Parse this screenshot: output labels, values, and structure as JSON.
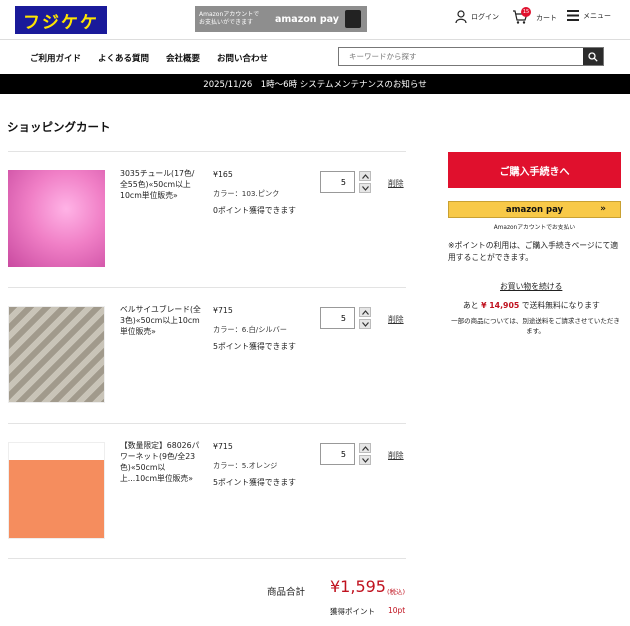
{
  "header": {
    "logo_text": "フジケケ",
    "amazon_banner": {
      "line1": "Amazonアカウントで",
      "line2": "お支払いができます",
      "brand": "amazon pay"
    },
    "login_label": "ログイン",
    "cart_label": "カート",
    "cart_count": "15",
    "menu_label": "メニュー"
  },
  "nav": {
    "items": [
      "ご利用ガイド",
      "よくある質問",
      "会社概要",
      "お問い合わせ"
    ]
  },
  "search": {
    "placeholder": "キーワードから探す"
  },
  "maintenance": {
    "text": "2025/11/26　1時〜6時 システムメンテナンスのお知らせ"
  },
  "page": {
    "title": "ショッピングカート"
  },
  "cart": {
    "items": [
      {
        "name": "3035チュール(17色/全55色)«50cm以上10cm単位販売»",
        "price": "¥165",
        "color": "カラー：103.ピンク",
        "points": "0ポイント獲得できます",
        "quantity": "5",
        "delete_label": "削除",
        "thumb_color": "#f07fc6"
      },
      {
        "name": "ベルサイユブレード(全3色)«50cm以上10cm単位販売»",
        "price": "¥715",
        "color": "カラー：6.白/シルバー",
        "points": "5ポイント獲得できます",
        "quantity": "5",
        "delete_label": "削除",
        "thumb_color": "#d9d6cf"
      },
      {
        "name": "【数量限定】68026パワーネット(9色/全23色)«50cm以上...10cm単位販売»",
        "price": "¥715",
        "color": "カラー：5.オレンジ",
        "points": "5ポイント獲得できます",
        "quantity": "5",
        "delete_label": "削除",
        "thumb_color": "#f58d5e"
      }
    ]
  },
  "summary": {
    "subtotal_label": "商品合計",
    "subtotal_value": "¥1,595",
    "tax_label": "(税込)",
    "points_label": "獲得ポイント",
    "points_value": "10pt"
  },
  "sidebar": {
    "checkout_label": "ご購入手続きへ",
    "amazonpay_label": "amazon pay",
    "amazonpay_chevron": "»",
    "amazon_sub": "Amazonアカウントでお支払い",
    "points_note": "※ポイントの利用は、ご購入手続きページにて適用することができます。",
    "continue_label": "お買い物を続ける",
    "free_ship_prefix": "あと",
    "free_ship_amount": "¥ 14,905",
    "free_ship_suffix": "で送料無料になります",
    "ship_note": "一部の商品については、別途送料をご請求させていただきます。"
  },
  "colors": {
    "accent": "#e0102d",
    "price_red": "#c0121f",
    "amazon_yellow": "#f8c948",
    "logo_bg": "#1a1a9a"
  }
}
